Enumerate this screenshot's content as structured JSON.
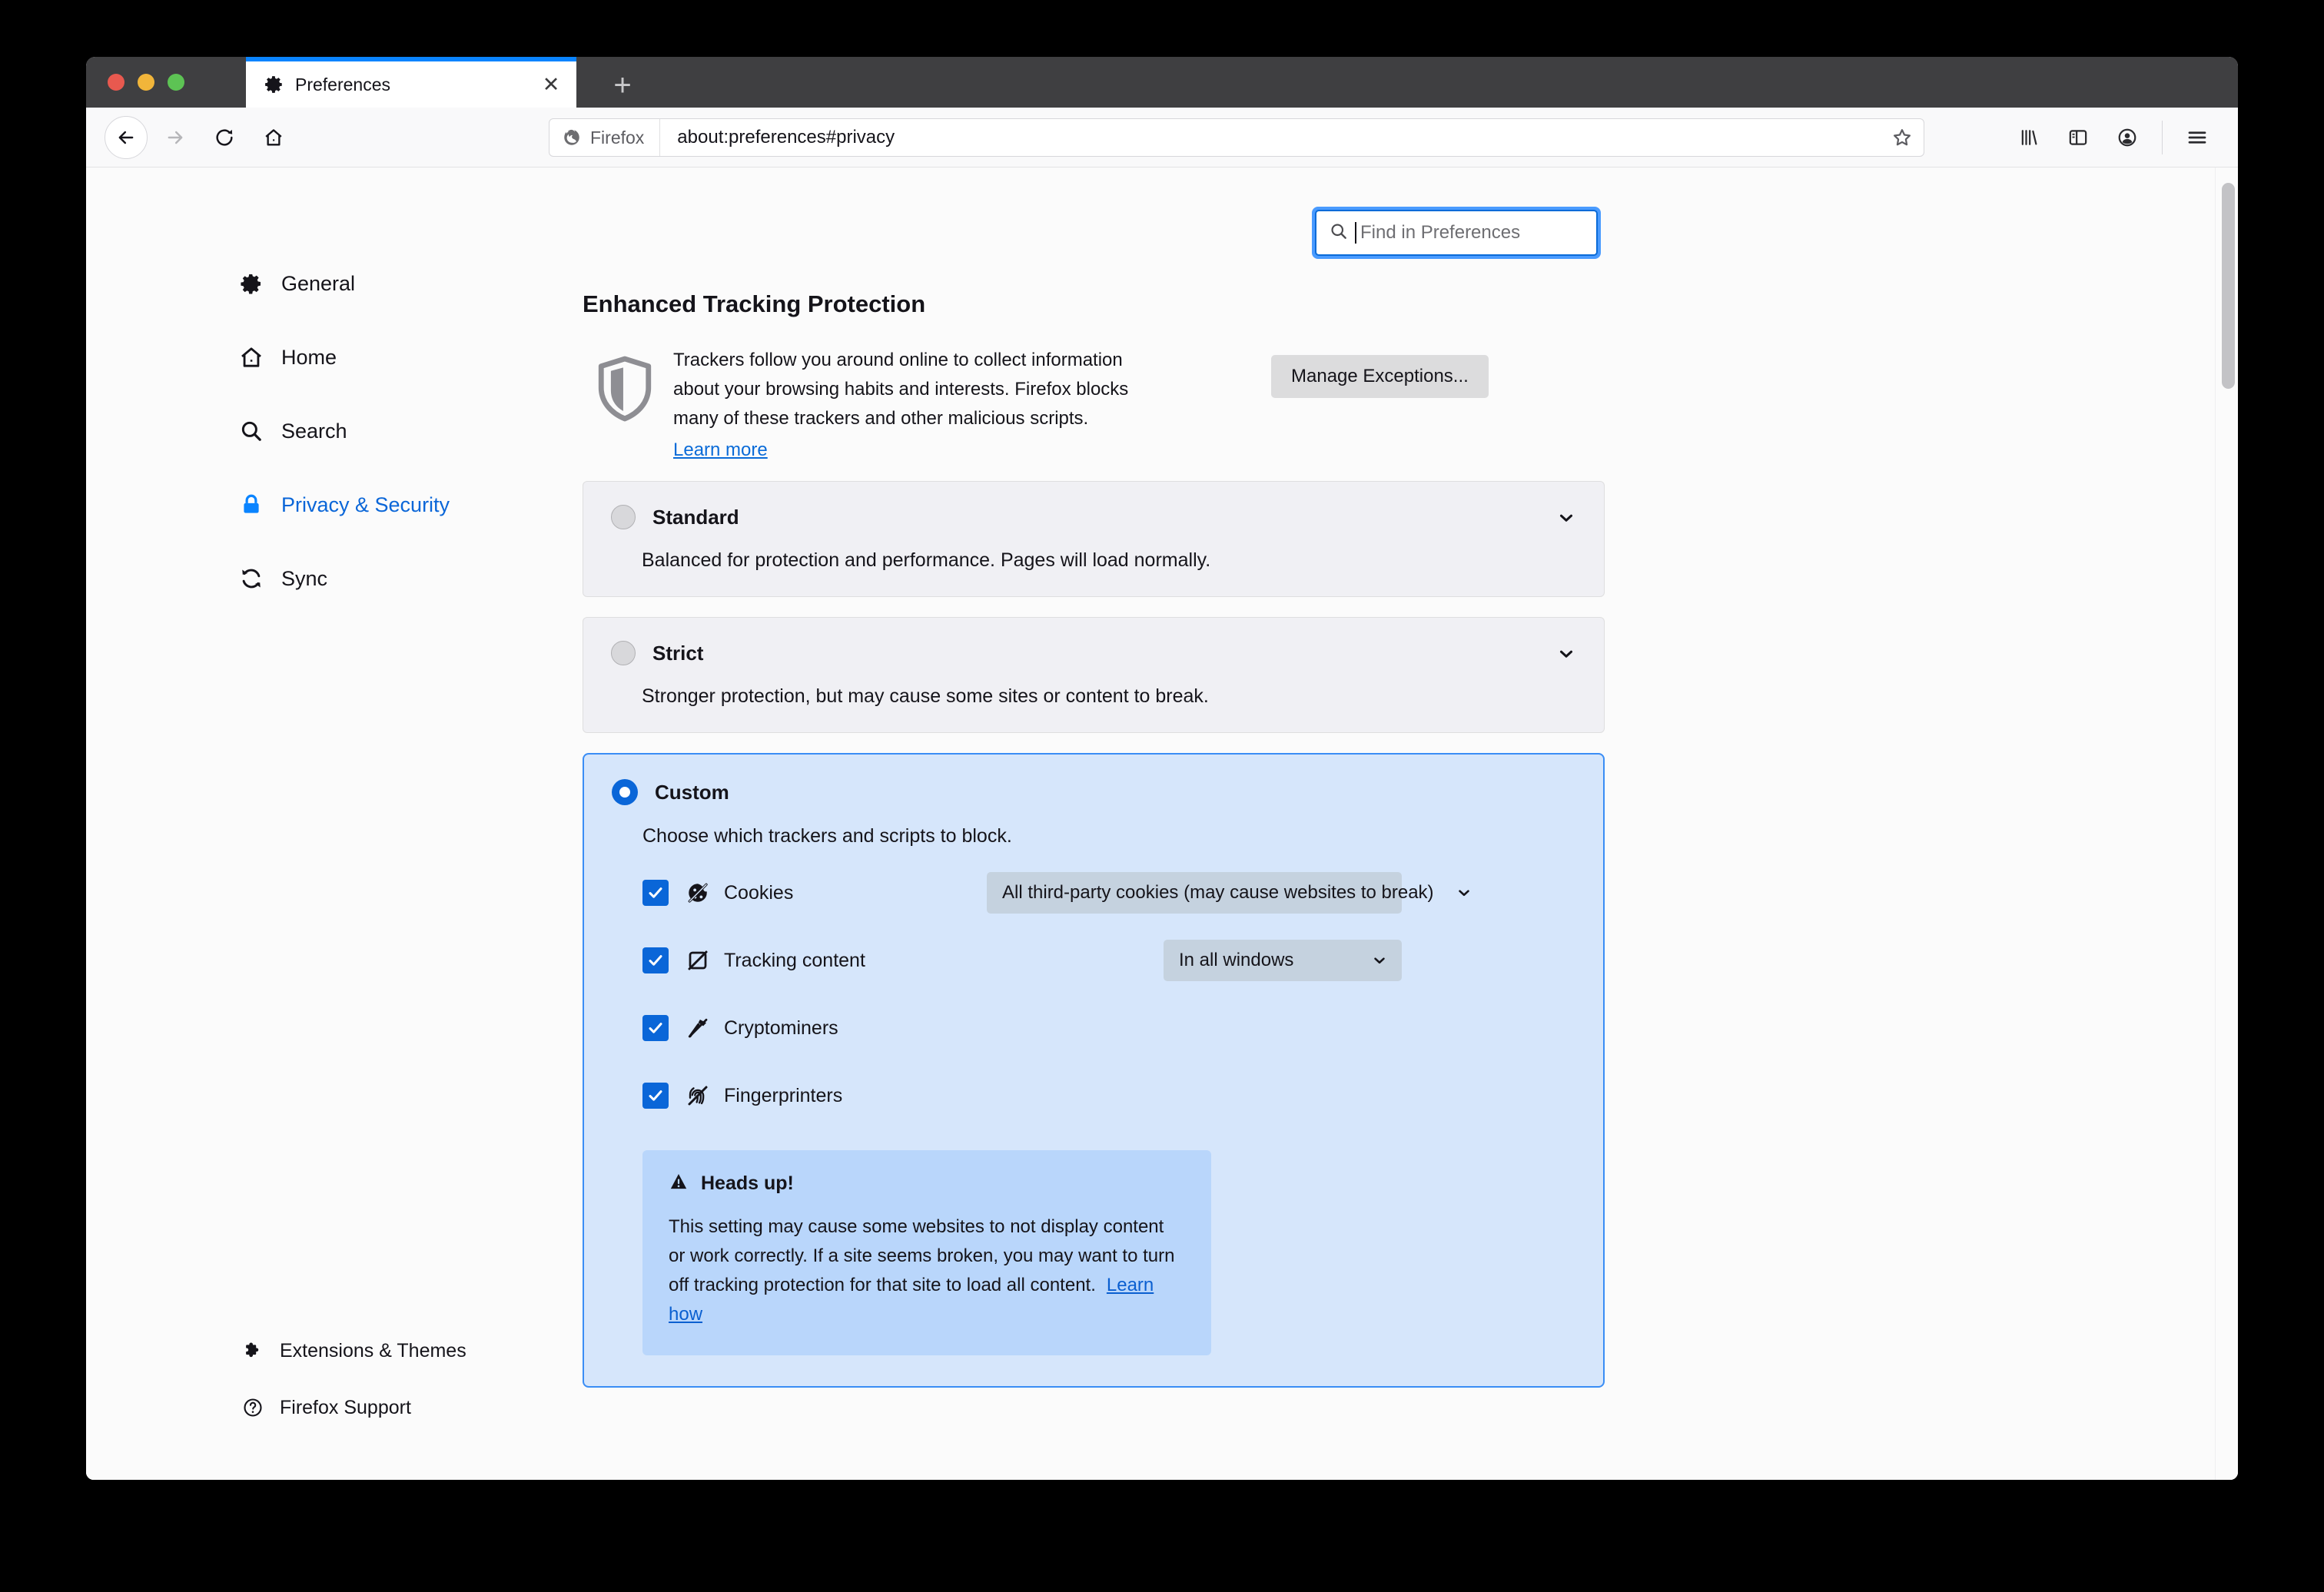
{
  "window": {
    "tab": {
      "title": "Preferences",
      "icon": "gear-icon",
      "close_label": "✕"
    },
    "new_tab_label": "+",
    "traffic_lights": [
      "close",
      "minimize",
      "zoom"
    ]
  },
  "toolbar": {
    "back_icon": "back-arrow-icon",
    "forward_icon": "forward-arrow-icon",
    "reload_icon": "reload-icon",
    "home_icon": "home-icon",
    "brand_label": "Firefox",
    "url": "about:preferences#privacy",
    "bookmark_icon": "star-icon",
    "library_icon": "library-icon",
    "sidebar_icon": "sidebar-icon",
    "account_icon": "account-icon",
    "menu_icon": "hamburger-menu-icon"
  },
  "search": {
    "placeholder": "Find in Preferences",
    "value": "",
    "icon": "search-icon"
  },
  "sidebar": {
    "items": [
      {
        "label": "General",
        "icon": "gear-icon",
        "active": false
      },
      {
        "label": "Home",
        "icon": "home-icon",
        "active": false
      },
      {
        "label": "Search",
        "icon": "search-icon",
        "active": false
      },
      {
        "label": "Privacy & Security",
        "icon": "lock-icon",
        "active": true
      },
      {
        "label": "Sync",
        "icon": "sync-icon",
        "active": false
      }
    ],
    "bottom_items": [
      {
        "label": "Extensions & Themes",
        "icon": "puzzle-piece-icon"
      },
      {
        "label": "Firefox Support",
        "icon": "question-circle-icon"
      }
    ]
  },
  "etp": {
    "title": "Enhanced Tracking Protection",
    "shield_icon": "shield-icon",
    "description_line1": "Trackers follow you around online to collect information",
    "description_line2": "about your browsing habits and interests. Firefox blocks",
    "description_line3": "many of these trackers and other malicious scripts.",
    "learn_more": "Learn more",
    "manage_exceptions": "Manage Exceptions..."
  },
  "modes": [
    {
      "id": "standard",
      "title": "Standard",
      "description": "Balanced for protection and performance. Pages will load normally.",
      "selected": false,
      "expand_icon": "chevron-down-icon"
    },
    {
      "id": "strict",
      "title": "Strict",
      "description": "Stronger protection, but may cause some sites or content to break.",
      "selected": false,
      "expand_icon": "chevron-down-icon"
    }
  ],
  "custom": {
    "title": "Custom",
    "description": "Choose which trackers and scripts to block.",
    "selected": true,
    "items": [
      {
        "label": "Cookies",
        "icon": "cookie-blocked-icon",
        "checked": true,
        "dropdown": {
          "value": "All third-party cookies (may cause websites to break)",
          "chevron": "chevron-down-icon"
        }
      },
      {
        "label": "Tracking content",
        "icon": "tracking-content-icon",
        "checked": true,
        "dropdown": {
          "value": "In all windows",
          "chevron": "chevron-down-icon"
        }
      },
      {
        "label": "Cryptominers",
        "icon": "cryptominer-icon",
        "checked": true,
        "dropdown": null
      },
      {
        "label": "Fingerprinters",
        "icon": "fingerprinter-icon",
        "checked": true,
        "dropdown": null
      }
    ],
    "headsup": {
      "icon": "warning-triangle-icon",
      "title": "Heads up!",
      "body": "This setting may cause some websites to not display content or work correctly. If a site seems broken, you may want to turn off tracking protection for that site to load all content.",
      "link": "Learn how"
    }
  },
  "colors": {
    "accent": "#0a66d8",
    "link": "#0a6bd8",
    "custom_panel_bg": "#d6e6fb",
    "custom_panel_border": "#3a8df5",
    "headsup_bg": "#b9d6fb",
    "card_bg": "#f0f0f4",
    "tab_active_line": "#0a84ff"
  }
}
